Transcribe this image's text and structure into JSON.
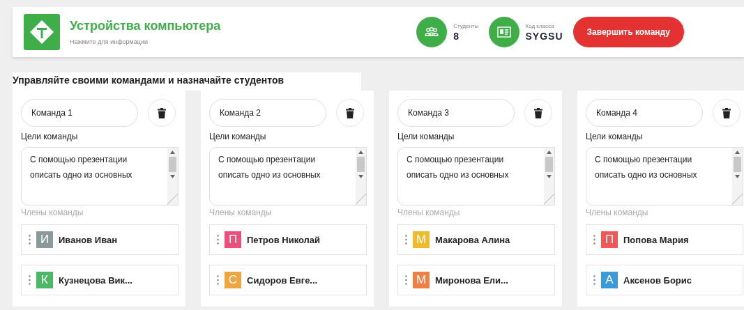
{
  "header": {
    "title": "Устройства компьютера",
    "subtitle": "Нажмите для информации",
    "stats": [
      {
        "kind": "students",
        "label": "Студенты",
        "value": "8"
      },
      {
        "kind": "code",
        "label": "Код класса",
        "value": "SYGSU"
      }
    ],
    "end_button": "Завершить команду"
  },
  "heading": "Управляйте своими командами и назначайте студентов",
  "teams": [
    {
      "name": "Команда 1",
      "goals_label": "Цели команды",
      "goals": "С помощью презентации описать одно из основных",
      "members_label": "Члены команды",
      "members": [
        {
          "initial": "И",
          "name": "Иванов Иван",
          "color": "#8a9a9b"
        },
        {
          "initial": "К",
          "name": "Кузнецова Вик...",
          "color": "#4cb866"
        }
      ]
    },
    {
      "name": "Команда 2",
      "goals_label": "Цели команды",
      "goals": "С помощью презентации описать одно из основных",
      "members_label": "Члены команды",
      "members": [
        {
          "initial": "П",
          "name": "Петров Николай",
          "color": "#ec4f7c"
        },
        {
          "initial": "С",
          "name": "Сидоров Евге...",
          "color": "#f0a640"
        }
      ]
    },
    {
      "name": "Команда 3",
      "goals_label": "Цели команды",
      "goals": "С помощью презентации описать одно из основных",
      "members_label": "Члены команды",
      "members": [
        {
          "initial": "М",
          "name": "Макарова Алина",
          "color": "#efbb2d"
        },
        {
          "initial": "М",
          "name": "Миронова Ели...",
          "color": "#f07f45"
        }
      ]
    },
    {
      "name": "Команда 4",
      "goals_label": "Цели команды",
      "goals": "С помощью презентации описать одно из основных",
      "members_label": "Члены команды",
      "members": [
        {
          "initial": "П",
          "name": "Попова Мария",
          "color": "#ee5858"
        },
        {
          "initial": "А",
          "name": "Аксенов Борис",
          "color": "#3b9ad8"
        }
      ]
    }
  ]
}
